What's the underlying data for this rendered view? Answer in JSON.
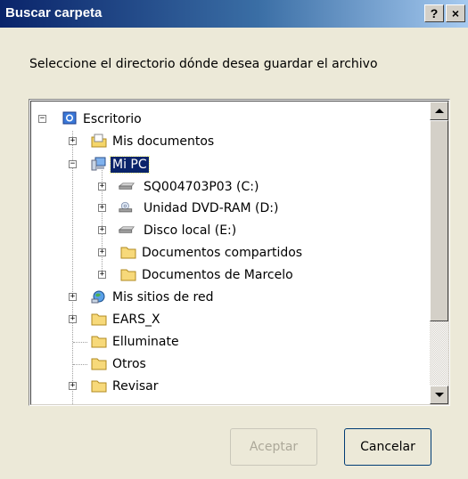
{
  "window": {
    "title": "Buscar carpeta",
    "help_label": "?",
    "close_label": "×"
  },
  "prompt": "Seleccione el directorio dónde desea guardar el archivo",
  "tree": {
    "items": [
      {
        "label": "Escritorio",
        "icon": "desktop-icon",
        "expander": "−"
      },
      {
        "label": "Mis documentos",
        "icon": "my-documents-icon",
        "expander": "+"
      },
      {
        "label": "Mi PC",
        "icon": "my-computer-icon",
        "expander": "−",
        "selected": true
      },
      {
        "label": "SQ004703P03 (C:)",
        "icon": "hard-drive-icon",
        "expander": "+"
      },
      {
        "label": "Unidad DVD-RAM (D:)",
        "icon": "dvd-drive-icon",
        "expander": "+"
      },
      {
        "label": "Disco local (E:)",
        "icon": "hard-drive-icon",
        "expander": "+"
      },
      {
        "label": "Documentos compartidos",
        "icon": "folder-icon",
        "expander": "+"
      },
      {
        "label": "Documentos de Marcelo",
        "icon": "folder-icon",
        "expander": "+"
      },
      {
        "label": "Mis sitios de red",
        "icon": "network-places-icon",
        "expander": "+"
      },
      {
        "label": "EARS_X",
        "icon": "folder-icon",
        "expander": "+"
      },
      {
        "label": "Elluminate",
        "icon": "folder-icon",
        "expander": ""
      },
      {
        "label": "Otros",
        "icon": "folder-icon",
        "expander": ""
      },
      {
        "label": "Revisar",
        "icon": "folder-icon",
        "expander": "+"
      }
    ]
  },
  "buttons": {
    "ok_label": "Aceptar",
    "cancel_label": "Cancelar"
  }
}
